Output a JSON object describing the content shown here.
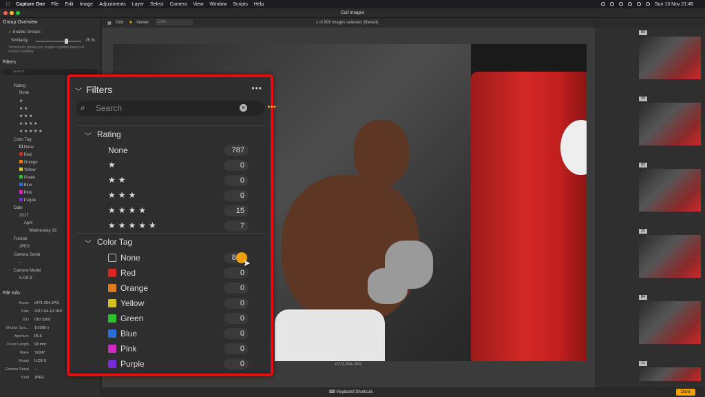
{
  "menubar": {
    "apple": "",
    "app": "Capture One",
    "items": [
      "File",
      "Edit",
      "Image",
      "Adjustments",
      "Layer",
      "Select",
      "Camera",
      "View",
      "Window",
      "Scripts",
      "Help"
    ],
    "clock": "Sun 13 Nov  21:46"
  },
  "window": {
    "title": "Cull Images",
    "traffic": [
      "#fe5f57",
      "#febc2e",
      "#28c840"
    ]
  },
  "left_panel": {
    "group_overview": "Group Overview",
    "enable_groups": "Enable Groups",
    "similarity": "Similarity",
    "similarity_value": "75 %",
    "group_desc": "Temporarily group your images together based on content similarity",
    "filters": "Filters",
    "search_placeholder": "Search",
    "rating": "Rating",
    "rating_items": [
      "None",
      "★",
      "★ ★",
      "★ ★ ★",
      "★ ★ ★ ★",
      "★ ★ ★ ★ ★"
    ],
    "color_tag": "Color Tag",
    "color_items": [
      "None",
      "Red",
      "Orange",
      "Yellow",
      "Green",
      "Blue",
      "Pink",
      "Purple"
    ],
    "date": "Date",
    "year": "2017",
    "month": "April",
    "day": "Wednesday 19",
    "format": "Format",
    "format_val": "JPEG",
    "camera_serial": "Camera Serial",
    "serial_val": "--",
    "camera_model": "Camera Model",
    "model_val": "ILCE-9",
    "file_info": "File Info",
    "info": [
      [
        "Name",
        "d771-004.JPG"
      ],
      [
        "Date",
        "2017-04-19 18:0"
      ],
      [
        "ISO",
        "ISO 3200"
      ],
      [
        "Shutter Spe...",
        "1/1000 s"
      ],
      [
        "Aperture",
        "f/5.6"
      ],
      [
        "Focal Length",
        "98 mm"
      ],
      [
        "Make",
        "SONY"
      ],
      [
        "Model",
        "ILCE-9"
      ],
      [
        "Camera Serial",
        "--"
      ],
      [
        "Kind",
        "JPEG"
      ]
    ]
  },
  "viewer_toolbar": {
    "grid": "Grid",
    "viewer": "Viewer",
    "sort": "Date",
    "status": "1 of 809 images selected (filtered)"
  },
  "viewer": {
    "filename": "d771-004.JPG"
  },
  "filmstrip": {
    "numbers": [
      "83",
      "20",
      "83",
      "35",
      "84",
      "11"
    ]
  },
  "bottom_bar": {
    "shortcuts": "Keyboard Shortcuts",
    "done": "Done"
  },
  "zoom_panel": {
    "title": "Filters",
    "menu": "•••",
    "search_placeholder": "Search",
    "rating_title": "Rating",
    "ratings": [
      {
        "label": "None",
        "count": "787"
      },
      {
        "stars": "★",
        "count": "0"
      },
      {
        "stars": "★★",
        "count": "0"
      },
      {
        "stars": "★★★",
        "count": "0"
      },
      {
        "stars": "★★★★",
        "count": "15"
      },
      {
        "stars": "★★★★★",
        "count": "7"
      }
    ],
    "color_title": "Color Tag",
    "colors": [
      {
        "label": "None",
        "count": "809",
        "color": "#2e2e2e"
      },
      {
        "label": "Red",
        "count": "0",
        "color": "#e02424"
      },
      {
        "label": "Orange",
        "count": "0",
        "color": "#e07a1a"
      },
      {
        "label": "Yellow",
        "count": "0",
        "color": "#d4c21c"
      },
      {
        "label": "Green",
        "count": "0",
        "color": "#2ec12e"
      },
      {
        "label": "Blue",
        "count": "0",
        "color": "#2a6fd8"
      },
      {
        "label": "Pink",
        "count": "0",
        "color": "#d22bc4"
      },
      {
        "label": "Purple",
        "count": "0",
        "color": "#7a2bd8"
      }
    ],
    "accent": "#f2a200"
  }
}
